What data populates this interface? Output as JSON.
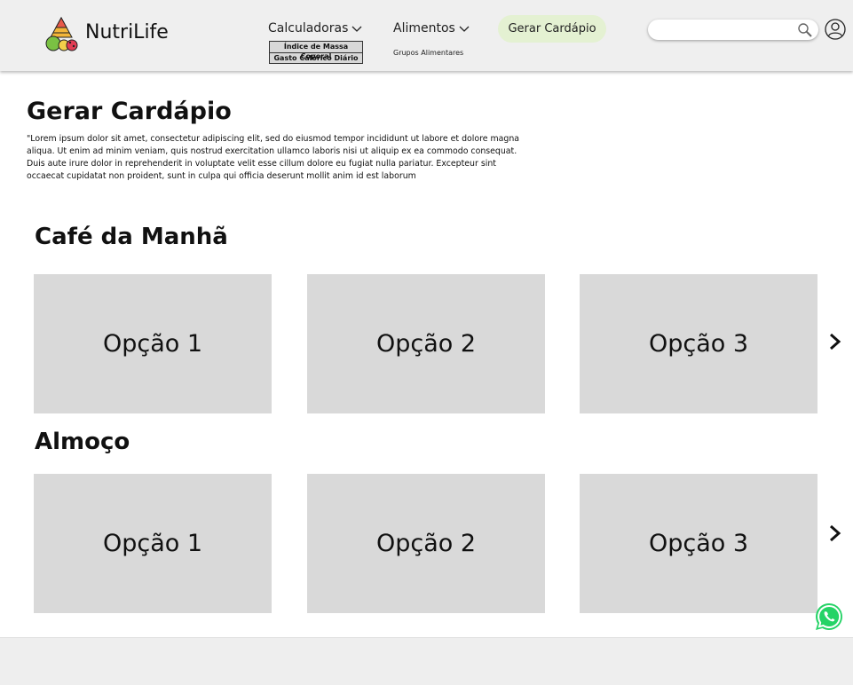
{
  "header": {
    "brand": "NutriLife",
    "nav": {
      "calculadoras": "Calculadoras",
      "calc_items": [
        "Índice de Massa Coporal",
        "Gasto Calórico Diário"
      ],
      "alimentos": "Alimentos",
      "alim_items": [
        "Grupos Alimentares"
      ]
    },
    "cta": "Gerar Cardápio",
    "search": {
      "value": "",
      "placeholder": ""
    }
  },
  "main": {
    "title": "Gerar Cardápio",
    "intro": "\"Lorem ipsum dolor sit amet, consectetur adipiscing elit, sed do eiusmod tempor incididunt ut labore et dolore magna aliqua. Ut enim ad minim veniam, quis nostrud exercitation ullamco laboris nisi ut aliquip ex ea commodo consequat. Duis aute irure dolor in reprehenderit in voluptate velit esse cillum dolore eu fugiat nulla pariatur. Excepteur sint occaecat cupidatat non proident, sunt in culpa qui officia deserunt mollit anim id est laborum",
    "sections": [
      {
        "title": "Café da Manhã",
        "options": [
          "Opção 1",
          "Opção 2",
          "Opção 3"
        ]
      },
      {
        "title": "Almoço",
        "options": [
          "Opção 1",
          "Opção 2",
          "Opção 3"
        ]
      }
    ]
  },
  "icons": {
    "logo": "food-pyramid-logo",
    "chevron": "chevron-down-icon",
    "search": "search-icon",
    "user": "user-icon",
    "next": "chevron-right-icon",
    "whatsapp": "whatsapp-icon"
  },
  "colors": {
    "header_bg": "#efefef",
    "cta_bg": "#e4f1d2",
    "card_bg": "#d9d9d9",
    "whatsapp": "#25d366"
  }
}
